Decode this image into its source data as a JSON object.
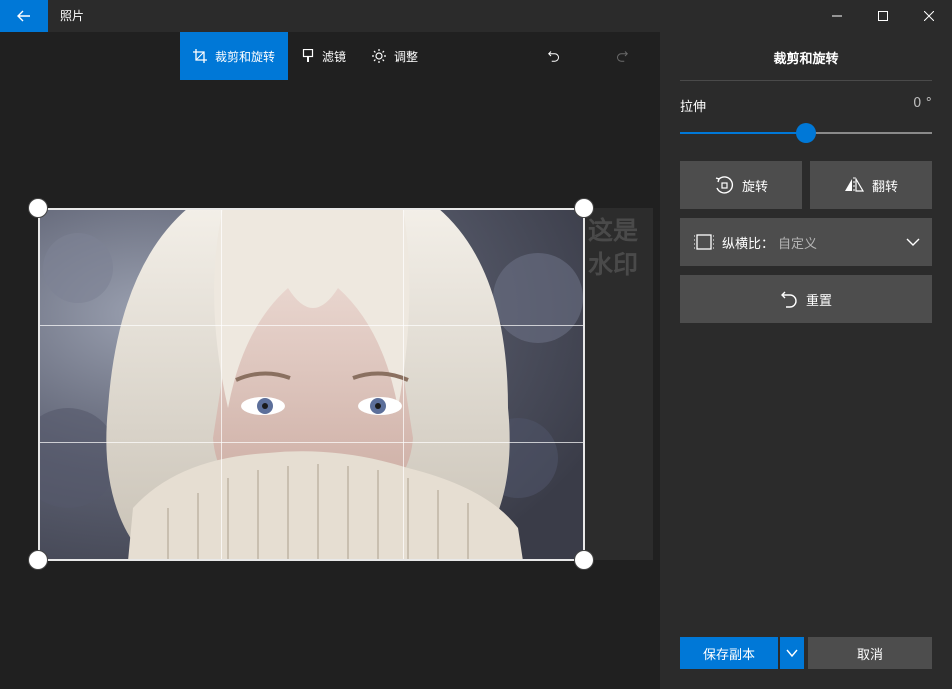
{
  "window": {
    "title": "照片",
    "back_icon": "back-arrow-icon",
    "minimize_icon": "minimize-icon",
    "maximize_icon": "maximize-icon",
    "close_icon": "close-icon"
  },
  "toolbar": {
    "crop_label": "裁剪和旋转",
    "filter_label": "滤镜",
    "adjust_label": "调整",
    "undo_icon": "undo-icon",
    "redo_icon": "redo-icon"
  },
  "canvas": {
    "watermark_line1": "这是",
    "watermark_line2": "水印"
  },
  "panel": {
    "title": "裁剪和旋转",
    "stretch_label": "拉伸",
    "stretch_value": "0 °",
    "stretch_level": 0.5,
    "rotate_label": "旋转",
    "flip_label": "翻转",
    "aspect_label": "纵横比：",
    "aspect_value": "自定义",
    "reset_label": "重置",
    "save_label": "保存副本",
    "cancel_label": "取消"
  },
  "colors": {
    "accent": "#0078d7",
    "background": "#202020",
    "panel": "#2b2b2b",
    "button": "#4d4d4d"
  }
}
